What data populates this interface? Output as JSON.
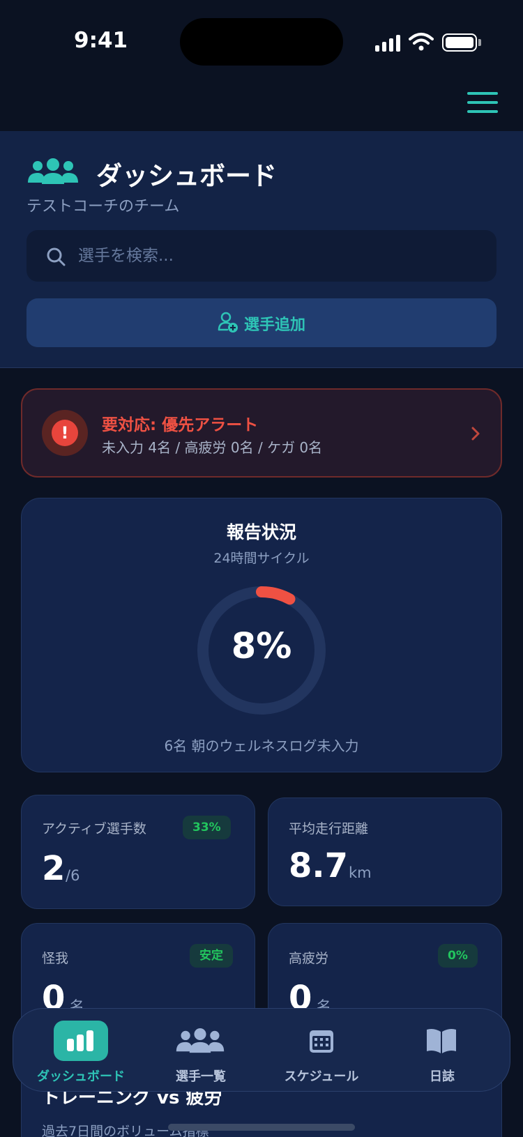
{
  "status_bar": {
    "time": "9:41"
  },
  "header": {
    "title": "ダッシュボード",
    "subtitle": "テストコーチのチーム",
    "search_placeholder": "選手を検索...",
    "add_player_label": "選手追加"
  },
  "alert": {
    "title": "要対応: 優先アラート",
    "detail": "未入力 4名 / 高疲労 0名 / ケガ 0名"
  },
  "report": {
    "title": "報告状況",
    "subtitle": "24時間サイクル",
    "percent_label": "8%",
    "progress": 0.08,
    "note": "6名 朝のウェルネスログ未入力"
  },
  "stats": {
    "active": {
      "label": "アクティブ選手数",
      "badge": "33%",
      "value": "2",
      "unit": "/6"
    },
    "distance": {
      "label": "平均走行距離",
      "value": "8.7",
      "unit": "km"
    },
    "injury": {
      "label": "怪我",
      "badge": "安定",
      "value": "0",
      "unit": "名"
    },
    "fatigue": {
      "label": "高疲労",
      "badge": "0%",
      "value": "0",
      "unit": "名"
    }
  },
  "next_section": {
    "title": "トレーニング vs 疲労",
    "subtitle": "過去7日間のボリューム指標"
  },
  "tabs": [
    {
      "label": "ダッシュボード",
      "icon": "bar-chart-icon",
      "active": true
    },
    {
      "label": "選手一覧",
      "icon": "team-icon",
      "active": false
    },
    {
      "label": "スケジュール",
      "icon": "calendar-icon",
      "active": false
    },
    {
      "label": "日誌",
      "icon": "book-icon",
      "active": false
    }
  ],
  "colors": {
    "accent": "#2ec4b6",
    "alert": "#ef5143",
    "success": "#22c55e",
    "background": "#0b1222",
    "card": "#14244a"
  }
}
